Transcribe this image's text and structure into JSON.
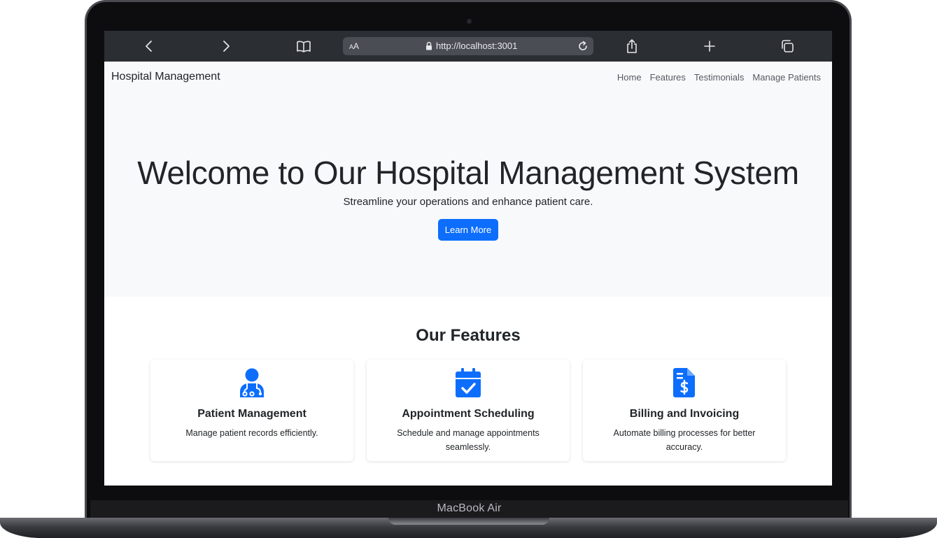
{
  "device": {
    "label": "MacBook Air"
  },
  "browser": {
    "text_size_small": "A",
    "text_size_large": "A",
    "url": "http://localhost:3001",
    "icons": [
      "back-icon",
      "forward-icon",
      "bookmarks-icon",
      "lock-icon",
      "reload-icon",
      "share-icon",
      "new-tab-icon",
      "tabs-icon"
    ]
  },
  "navbar": {
    "brand": "Hospital Management",
    "links": [
      "Home",
      "Features",
      "Testimonials",
      "Manage Patients"
    ]
  },
  "hero": {
    "title": "Welcome to Our Hospital Management System",
    "subtitle": "Streamline your operations and enhance patient care.",
    "button_label": "Learn More"
  },
  "features": {
    "title": "Our Features",
    "cards": [
      {
        "icon": "doctor-icon",
        "title": "Patient Management",
        "description": "Manage patient records efficiently."
      },
      {
        "icon": "calendar-check-icon",
        "title": "Appointment Scheduling",
        "description": "Schedule and manage appointments seamlessly."
      },
      {
        "icon": "invoice-dollar-icon",
        "title": "Billing and Invoicing",
        "description": "Automate billing processes for better accuracy."
      }
    ]
  },
  "colors": {
    "primary": "#0d6efd",
    "navbar_bg": "#f8f9fa",
    "browser_bar": "#2b2e33"
  }
}
